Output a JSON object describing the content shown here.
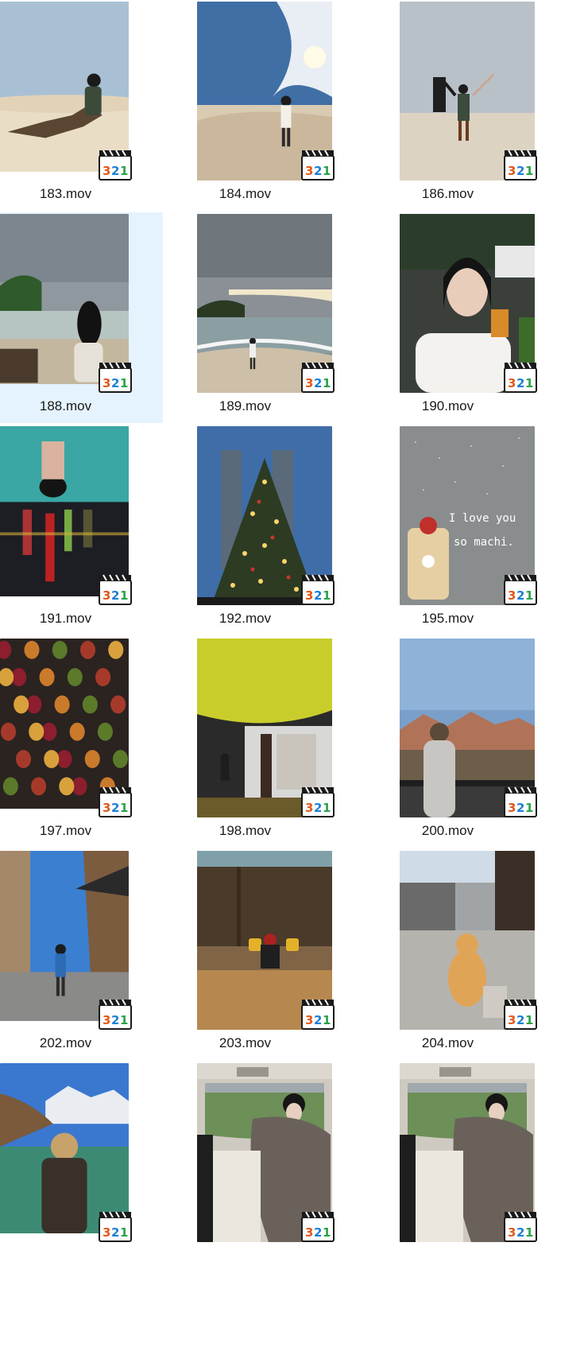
{
  "files": [
    {
      "name": "183.mov",
      "scene": "desert-sit",
      "selected": false
    },
    {
      "name": "184.mov",
      "scene": "desert-stand",
      "selected": false
    },
    {
      "name": "186.mov",
      "scene": "desert-arms",
      "selected": false
    },
    {
      "name": "188.mov",
      "scene": "beach-sit",
      "selected": true
    },
    {
      "name": "189.mov",
      "scene": "beach-walk",
      "selected": false
    },
    {
      "name": "190.mov",
      "scene": "selfie-drink",
      "selected": false
    },
    {
      "name": "191.mov",
      "scene": "pool-city",
      "selected": false
    },
    {
      "name": "192.mov",
      "scene": "christmas-tree",
      "selected": false
    },
    {
      "name": "195.mov",
      "scene": "love-wall",
      "selected": false
    },
    {
      "name": "197.mov",
      "scene": "fruit-pattern",
      "selected": false
    },
    {
      "name": "198.mov",
      "scene": "ginkgo-street",
      "selected": false
    },
    {
      "name": "200.mov",
      "scene": "mountain-view",
      "selected": false
    },
    {
      "name": "202.mov",
      "scene": "old-town-street",
      "selected": false
    },
    {
      "name": "203.mov",
      "scene": "cafe-chairs",
      "selected": false
    },
    {
      "name": "204.mov",
      "scene": "cat-street",
      "selected": false
    },
    {
      "name": "",
      "scene": "snow-mountain-lake",
      "selected": false
    },
    {
      "name": "",
      "scene": "car-fur-1",
      "selected": false
    },
    {
      "name": "",
      "scene": "car-fur-2",
      "selected": false
    }
  ],
  "badge": {
    "text": "321",
    "icon": "mpc-hc-video-icon"
  }
}
